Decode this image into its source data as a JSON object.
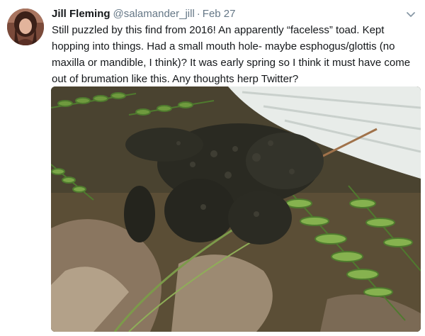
{
  "tweet": {
    "display_name": "Jill Fleming",
    "handle": "@salamander_jill",
    "separator": "·",
    "date": "Feb 27",
    "text": "Still puzzled by this find from 2016! An apparently “faceless” toad. Kept hopping into things. Had a small mouth hole- maybe esphogus/glottis (no maxilla or mandible, I think)? It was early spring so I think it must have come out of brumation like this. Any thoughts herp Twitter?",
    "menu_icon": "chevron-down-icon",
    "avatar_icon": "profile-photo",
    "media_icon": "toad-photo"
  },
  "colors": {
    "name": "#14171a",
    "meta": "#657786",
    "caret": "#8899a6"
  }
}
